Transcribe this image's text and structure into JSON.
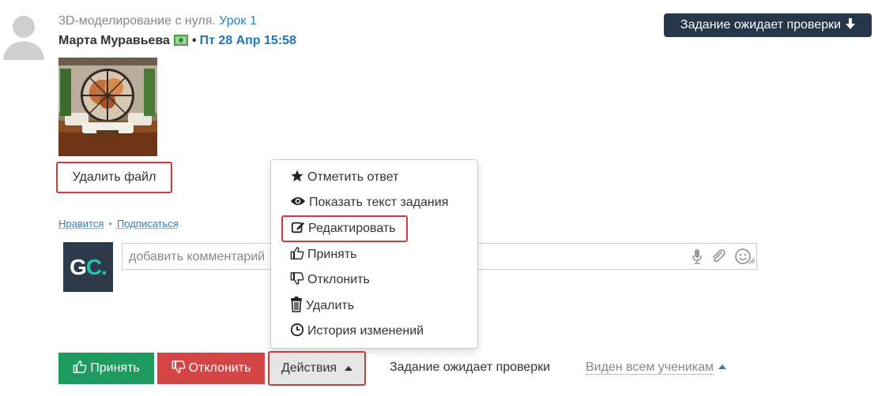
{
  "post": {
    "lesson_prefix": "3D-моделирование с нуля.",
    "lesson_link": "Урок 1",
    "author": "Марта Муравьева",
    "bullet": "•",
    "date": "Пт 28 Апр 15:58",
    "status_badge": "Задание ожидает проверки"
  },
  "file": {
    "delete_label": "Удалить файл"
  },
  "social": {
    "like": "Нравится",
    "separator": "•",
    "subscribe": "Подписаться"
  },
  "comment": {
    "placeholder": "добавить комментарий"
  },
  "logo": {
    "g": "G",
    "c": "C."
  },
  "menu": {
    "items": [
      {
        "label": "Отметить ответ",
        "icon": "star-icon"
      },
      {
        "label": "Показать текст задания",
        "icon": "eye-icon"
      },
      {
        "label": "Редактировать",
        "icon": "edit-icon"
      },
      {
        "label": "Принять",
        "icon": "thumbs-up-icon"
      },
      {
        "label": "Отклонить",
        "icon": "thumbs-down-icon"
      },
      {
        "label": "Удалить",
        "icon": "trash-icon"
      },
      {
        "label": "История изменений",
        "icon": "clock-icon"
      }
    ]
  },
  "footer": {
    "accept_label": "Принять",
    "reject_label": "Отклонить",
    "actions_label": "Действия",
    "status_text": "Задание ожидает проверки",
    "visibility": "Виден всем ученикам"
  },
  "colors": {
    "accept": "#1e9b5e",
    "reject": "#d64545",
    "badge": "#25364a",
    "link": "#2f7fc1",
    "highlight": "#d9383a"
  }
}
